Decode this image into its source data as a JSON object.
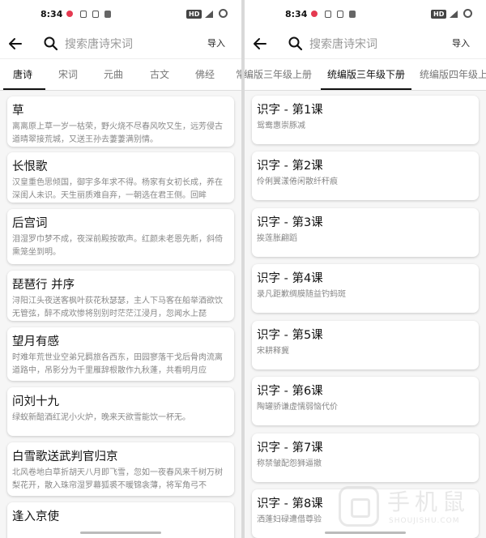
{
  "status_bar": {
    "time": "8:34",
    "hd_badge": "HD"
  },
  "search": {
    "placeholder": "搜索唐诗宋词"
  },
  "toolbar": {
    "import_label": "导入"
  },
  "left_panel": {
    "tabs": [
      {
        "label": "唐诗",
        "active": true
      },
      {
        "label": "宋词",
        "active": false
      },
      {
        "label": "元曲",
        "active": false
      },
      {
        "label": "古文",
        "active": false
      },
      {
        "label": "佛经",
        "active": false
      },
      {
        "label": "常",
        "active": false
      }
    ],
    "poems": [
      {
        "title": "草",
        "excerpt": "离离原上草一岁一枯荣，野火烧不尽春风吹又生，远芳侵古道晴翠接荒城，又送王孙去萋萋满别情。"
      },
      {
        "title": "长恨歌",
        "excerpt": "汉皇重色思倾国，御宇多年求不得。杨家有女初长成，养在深闺人未识。天生丽质难自弃，一朝选在君王侧。回眸"
      },
      {
        "title": "后宫词",
        "excerpt": "泪湿罗巾梦不成，夜深前殿按歌声。红颜未老恩先断，斜倚熏笼坐到明。"
      },
      {
        "title": "琵琶行 并序",
        "excerpt": "浔阳江头夜送客枫叶荻花秋瑟瑟，主人下马客在船举酒欲饮无管弦，醉不成欢惨将别别时茫茫江浸月，忽闻水上琵"
      },
      {
        "title": "望月有感",
        "excerpt": "时难年荒世业空弟兄羁旅各西东，田园寥落干戈后骨肉流离道路中，吊影分为千里雁辞根散作九秋蓬，共看明月应"
      },
      {
        "title": "问刘十九",
        "excerpt": "绿蚁新醅酒红泥小火炉，晚来天欲雪能饮一杯无。"
      },
      {
        "title": "白雪歌送武判官归京",
        "excerpt": "北风卷地白草折胡天八月即飞雪，忽如一夜春风来千树万树梨花开，散入珠帘湿罗幕狐裘不暖锦衾薄，将军角弓不"
      },
      {
        "title": "逢入京使",
        "excerpt": ""
      }
    ]
  },
  "right_panel": {
    "tabs": [
      {
        "label": "编版三年级上册",
        "active": false
      },
      {
        "label": "统编版三年级下册",
        "active": true
      },
      {
        "label": "统编版四年级上",
        "active": false
      }
    ],
    "lessons": [
      {
        "title": "识字 - 第1课",
        "chars": "鸳鸯惠崇豚减"
      },
      {
        "title": "识字 - 第2课",
        "chars": "伶俐翼漾倦闲散纤秆痕"
      },
      {
        "title": "识字 - 第3课",
        "chars": "挨莲胀翩蹈"
      },
      {
        "title": "识字 - 第4课",
        "chars": "录凡距歉绸膜随益钓蚂斑"
      },
      {
        "title": "识字 - 第5课",
        "chars": "宋耕释冀"
      },
      {
        "title": "识字 - 第6课",
        "chars": "陶罐骄谦虚懦弱恼代价"
      },
      {
        "title": "识字 - 第7课",
        "chars": "称禁皱配怨狮逼撤"
      },
      {
        "title": "识字 - 第8课",
        "chars": "洒蓬妇碌遭借尊验"
      }
    ]
  },
  "watermark": {
    "cn": "手机鼠",
    "en": "SHOUJISHU.COM"
  },
  "colors": {
    "accent": "#111111",
    "card_bg": "#ffffff",
    "muted_text": "#888888",
    "status_red": "#e53950"
  }
}
